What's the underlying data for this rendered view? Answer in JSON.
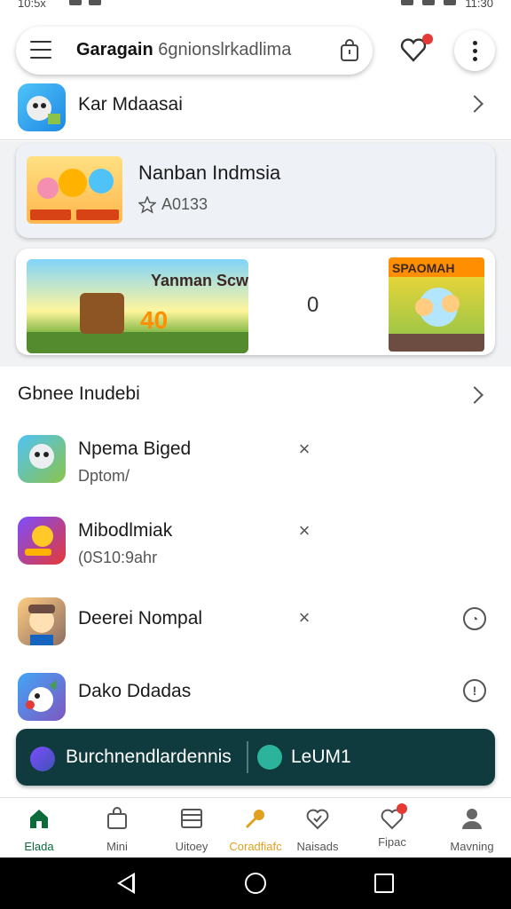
{
  "status": {
    "time_left": "10:5x",
    "time_right": "11:30"
  },
  "search": {
    "brand": "Garagain",
    "rest": "6gnionslrkadlima"
  },
  "top_row": {
    "title": "Kar Mdaasai"
  },
  "featured": {
    "title": "Nanban Indmsia",
    "rating": "A0133"
  },
  "banner": {
    "left_title": "Yanman Scwall",
    "left_number": "40",
    "count": "0",
    "right_title": "SPAOMAH"
  },
  "section": {
    "title": "Gbnee Inudebi"
  },
  "list": [
    {
      "title": "Npema Biged",
      "sub": "Dptom/",
      "action": "×",
      "trailing": ""
    },
    {
      "title": "Mibodlmiak",
      "sub": "(0S10:9ahr",
      "action": "×",
      "trailing": ""
    },
    {
      "title": "Deerei Nompal",
      "sub": "",
      "action": "×",
      "trailing": "clock-icon"
    },
    {
      "title": "Dako Ddadas",
      "sub": "",
      "action": "",
      "trailing": "info-icon"
    }
  ],
  "promo": {
    "left": "Burchnendlardennis",
    "right": "LeUM1"
  },
  "nav": [
    {
      "label": "Elada",
      "icon": "home-icon"
    },
    {
      "label": "Mini",
      "icon": "bag-icon"
    },
    {
      "label": "Uitoey",
      "icon": "library-icon"
    },
    {
      "label": "Coradfiafc",
      "icon": "key-icon"
    },
    {
      "label": "Naisads",
      "icon": "badge-icon"
    },
    {
      "label": "Fipac",
      "icon": "heart-badge-icon"
    },
    {
      "label": "Mavning",
      "icon": "person-icon"
    }
  ],
  "colors": {
    "accent": "#0f3b3e",
    "active_nav": "#0b6b3a",
    "badge": "#e53935",
    "gold": "#e0a020"
  }
}
